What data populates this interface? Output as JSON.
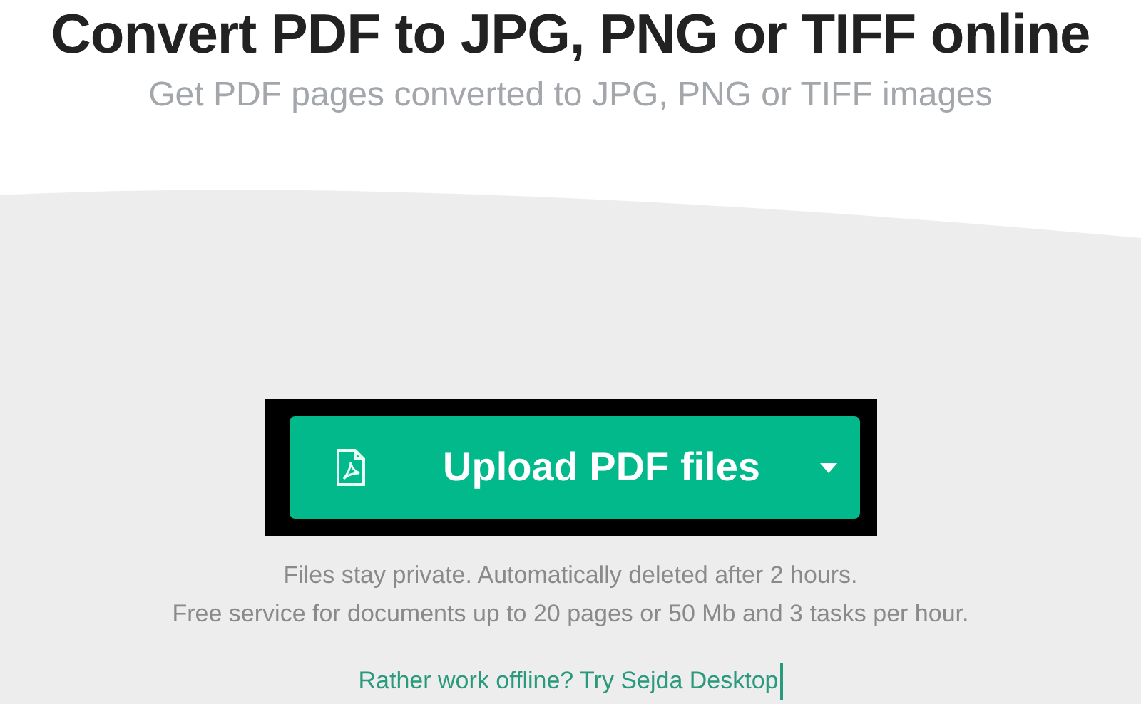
{
  "title": "Convert PDF to JPG, PNG or TIFF online",
  "subtitle": "Get PDF pages converted to JPG, PNG or TIFF images",
  "upload_button": {
    "label": "Upload PDF files"
  },
  "notes": [
    "Files stay private. Automatically deleted after 2 hours.",
    "Free service for documents up to 20 pages or 50 Mb and 3 tasks per hour."
  ],
  "offline_link": "Rather work offline? Try Sejda Desktop"
}
